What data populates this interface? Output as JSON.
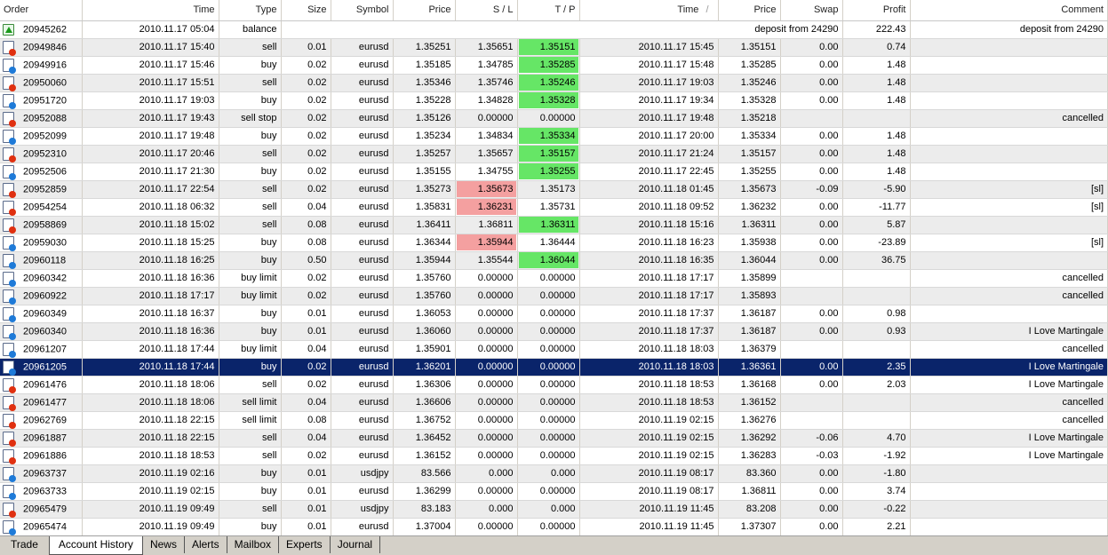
{
  "colors": {
    "tp_hit": "#66e666",
    "sl_hit": "#f4a0a0",
    "selected": "#0a246a",
    "sell_icon": "#e03010",
    "buy_icon": "#1e7ad8"
  },
  "columns": [
    "Order",
    "Time",
    "Type",
    "Size",
    "Symbol",
    "Price",
    "S / L",
    "T / P",
    "Time",
    "Price",
    "Swap",
    "Profit",
    "Comment"
  ],
  "sort_indicator": "/",
  "balance_row": {
    "order": "20945262",
    "time": "2010.11.17 05:04",
    "type": "balance",
    "description": "deposit from 24290",
    "profit": "222.43",
    "comment": "deposit from 24290",
    "icon": "balance-arrow-icon"
  },
  "rows": [
    [
      "20949846",
      "2010.11.17 15:40",
      "sell",
      "0.01",
      "eurusd",
      "1.35251",
      "1.35651",
      "1.35151",
      "2010.11.17 15:45",
      "1.35151",
      "0.00",
      "0.74",
      "",
      "",
      "tp"
    ],
    [
      "20949916",
      "2010.11.17 15:46",
      "buy",
      "0.02",
      "eurusd",
      "1.35185",
      "1.34785",
      "1.35285",
      "2010.11.17 15:48",
      "1.35285",
      "0.00",
      "1.48",
      "",
      "",
      "tp"
    ],
    [
      "20950060",
      "2010.11.17 15:51",
      "sell",
      "0.02",
      "eurusd",
      "1.35346",
      "1.35746",
      "1.35246",
      "2010.11.17 19:03",
      "1.35246",
      "0.00",
      "1.48",
      "",
      "",
      "tp"
    ],
    [
      "20951720",
      "2010.11.17 19:03",
      "buy",
      "0.02",
      "eurusd",
      "1.35228",
      "1.34828",
      "1.35328",
      "2010.11.17 19:34",
      "1.35328",
      "0.00",
      "1.48",
      "",
      "",
      "tp"
    ],
    [
      "20952088",
      "2010.11.17 19:43",
      "sell stop",
      "0.02",
      "eurusd",
      "1.35126",
      "0.00000",
      "0.00000",
      "2010.11.17 19:48",
      "1.35218",
      "",
      "",
      "cancelled",
      "",
      ""
    ],
    [
      "20952099",
      "2010.11.17 19:48",
      "buy",
      "0.02",
      "eurusd",
      "1.35234",
      "1.34834",
      "1.35334",
      "2010.11.17 20:00",
      "1.35334",
      "0.00",
      "1.48",
      "",
      "",
      "tp"
    ],
    [
      "20952310",
      "2010.11.17 20:46",
      "sell",
      "0.02",
      "eurusd",
      "1.35257",
      "1.35657",
      "1.35157",
      "2010.11.17 21:24",
      "1.35157",
      "0.00",
      "1.48",
      "",
      "",
      "tp"
    ],
    [
      "20952506",
      "2010.11.17 21:30",
      "buy",
      "0.02",
      "eurusd",
      "1.35155",
      "1.34755",
      "1.35255",
      "2010.11.17 22:45",
      "1.35255",
      "0.00",
      "1.48",
      "",
      "",
      "tp"
    ],
    [
      "20952859",
      "2010.11.17 22:54",
      "sell",
      "0.02",
      "eurusd",
      "1.35273",
      "1.35673",
      "1.35173",
      "2010.11.18 01:45",
      "1.35673",
      "-0.09",
      "-5.90",
      "[sl]",
      "sl",
      ""
    ],
    [
      "20954254",
      "2010.11.18 06:32",
      "sell",
      "0.04",
      "eurusd",
      "1.35831",
      "1.36231",
      "1.35731",
      "2010.11.18 09:52",
      "1.36232",
      "0.00",
      "-11.77",
      "[sl]",
      "sl",
      ""
    ],
    [
      "20958869",
      "2010.11.18 15:02",
      "sell",
      "0.08",
      "eurusd",
      "1.36411",
      "1.36811",
      "1.36311",
      "2010.11.18 15:16",
      "1.36311",
      "0.00",
      "5.87",
      "",
      "",
      "tp"
    ],
    [
      "20959030",
      "2010.11.18 15:25",
      "buy",
      "0.08",
      "eurusd",
      "1.36344",
      "1.35944",
      "1.36444",
      "2010.11.18 16:23",
      "1.35938",
      "0.00",
      "-23.89",
      "[sl]",
      "sl",
      ""
    ],
    [
      "20960118",
      "2010.11.18 16:25",
      "buy",
      "0.50",
      "eurusd",
      "1.35944",
      "1.35544",
      "1.36044",
      "2010.11.18 16:35",
      "1.36044",
      "0.00",
      "36.75",
      "",
      "",
      "tp"
    ],
    [
      "20960342",
      "2010.11.18 16:36",
      "buy limit",
      "0.02",
      "eurusd",
      "1.35760",
      "0.00000",
      "0.00000",
      "2010.11.18 17:17",
      "1.35899",
      "",
      "",
      "cancelled",
      "",
      ""
    ],
    [
      "20960922",
      "2010.11.18 17:17",
      "buy limit",
      "0.02",
      "eurusd",
      "1.35760",
      "0.00000",
      "0.00000",
      "2010.11.18 17:17",
      "1.35893",
      "",
      "",
      "cancelled",
      "",
      ""
    ],
    [
      "20960349",
      "2010.11.18 16:37",
      "buy",
      "0.01",
      "eurusd",
      "1.36053",
      "0.00000",
      "0.00000",
      "2010.11.18 17:37",
      "1.36187",
      "0.00",
      "0.98",
      "",
      "",
      ""
    ],
    [
      "20960340",
      "2010.11.18 16:36",
      "buy",
      "0.01",
      "eurusd",
      "1.36060",
      "0.00000",
      "0.00000",
      "2010.11.18 17:37",
      "1.36187",
      "0.00",
      "0.93",
      "I Love Martingale",
      "",
      ""
    ],
    [
      "20961207",
      "2010.11.18 17:44",
      "buy limit",
      "0.04",
      "eurusd",
      "1.35901",
      "0.00000",
      "0.00000",
      "2010.11.18 18:03",
      "1.36379",
      "",
      "",
      "cancelled",
      "",
      ""
    ],
    [
      "20961205",
      "2010.11.18 17:44",
      "buy",
      "0.02",
      "eurusd",
      "1.36201",
      "0.00000",
      "0.00000",
      "2010.11.18 18:03",
      "1.36361",
      "0.00",
      "2.35",
      "I Love Martingale",
      "",
      ""
    ],
    [
      "20961476",
      "2010.11.18 18:06",
      "sell",
      "0.02",
      "eurusd",
      "1.36306",
      "0.00000",
      "0.00000",
      "2010.11.18 18:53",
      "1.36168",
      "0.00",
      "2.03",
      "I Love Martingale",
      "",
      ""
    ],
    [
      "20961477",
      "2010.11.18 18:06",
      "sell limit",
      "0.04",
      "eurusd",
      "1.36606",
      "0.00000",
      "0.00000",
      "2010.11.18 18:53",
      "1.36152",
      "",
      "",
      "cancelled",
      "",
      ""
    ],
    [
      "20962769",
      "2010.11.18 22:15",
      "sell limit",
      "0.08",
      "eurusd",
      "1.36752",
      "0.00000",
      "0.00000",
      "2010.11.19 02:15",
      "1.36276",
      "",
      "",
      "cancelled",
      "",
      ""
    ],
    [
      "20961887",
      "2010.11.18 22:15",
      "sell",
      "0.04",
      "eurusd",
      "1.36452",
      "0.00000",
      "0.00000",
      "2010.11.19 02:15",
      "1.36292",
      "-0.06",
      "4.70",
      "I Love Martingale",
      "",
      ""
    ],
    [
      "20961886",
      "2010.11.18 18:53",
      "sell",
      "0.02",
      "eurusd",
      "1.36152",
      "0.00000",
      "0.00000",
      "2010.11.19 02:15",
      "1.36283",
      "-0.03",
      "-1.92",
      "I Love Martingale",
      "",
      ""
    ],
    [
      "20963737",
      "2010.11.19 02:16",
      "buy",
      "0.01",
      "usdjpy",
      "83.566",
      "0.000",
      "0.000",
      "2010.11.19 08:17",
      "83.360",
      "0.00",
      "-1.80",
      "",
      "",
      ""
    ],
    [
      "20963733",
      "2010.11.19 02:15",
      "buy",
      "0.01",
      "eurusd",
      "1.36299",
      "0.00000",
      "0.00000",
      "2010.11.19 08:17",
      "1.36811",
      "0.00",
      "3.74",
      "",
      "",
      ""
    ],
    [
      "20965479",
      "2010.11.19 09:49",
      "sell",
      "0.01",
      "usdjpy",
      "83.183",
      "0.000",
      "0.000",
      "2010.11.19 11:45",
      "83.208",
      "0.00",
      "-0.22",
      "",
      "",
      ""
    ],
    [
      "20965474",
      "2010.11.19 09:49",
      "buy",
      "0.01",
      "eurusd",
      "1.37004",
      "0.00000",
      "0.00000",
      "2010.11.19 11:45",
      "1.37307",
      "0.00",
      "2.21",
      "",
      "",
      ""
    ]
  ],
  "selected_order": "20961205",
  "tabs": [
    {
      "label": "Trade",
      "active": false
    },
    {
      "label": "Account History",
      "active": true
    },
    {
      "label": "News",
      "active": false
    },
    {
      "label": "Alerts",
      "active": false
    },
    {
      "label": "Mailbox",
      "active": false
    },
    {
      "label": "Experts",
      "active": false
    },
    {
      "label": "Journal",
      "active": false
    }
  ]
}
